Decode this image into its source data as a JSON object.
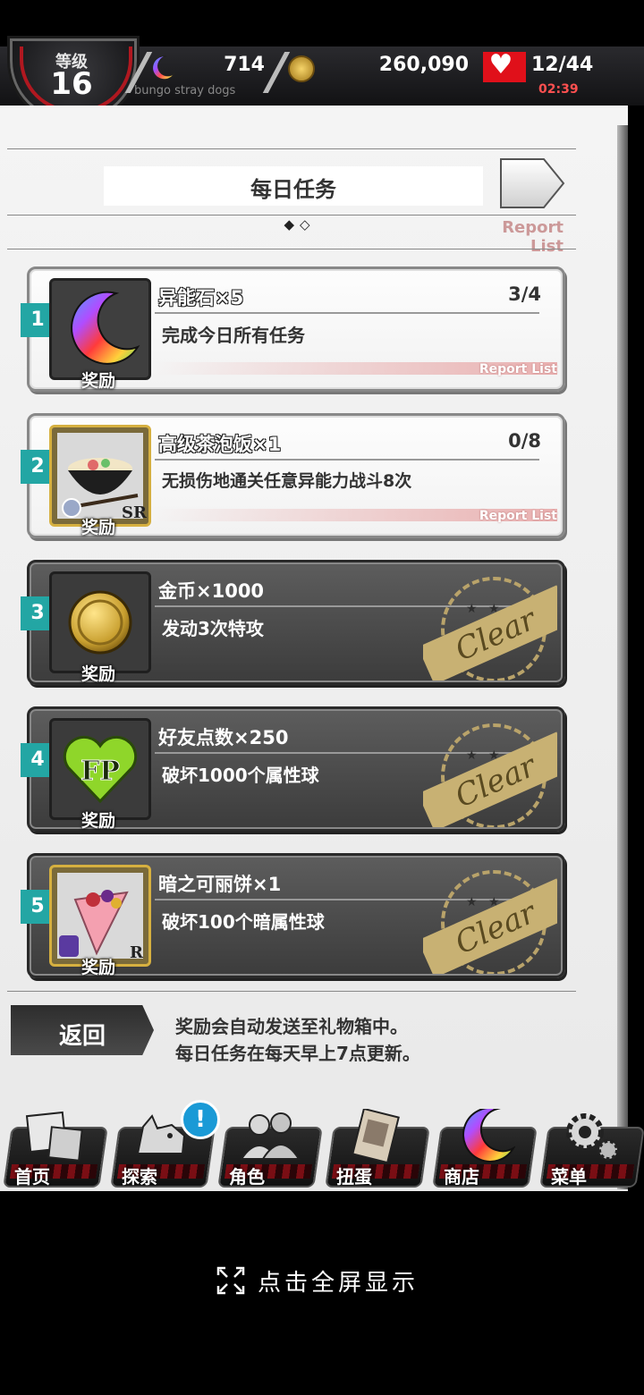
{
  "status": {
    "level_label": "等级",
    "level": "16",
    "stones": "714",
    "coins": "260,090",
    "stamina": "12/44",
    "stamina_timer": "02:39",
    "subtitle": "bungo stray dogs"
  },
  "header": {
    "title": "每日任务",
    "page_dots": "◆◇",
    "report_list": "Report List"
  },
  "missions": [
    {
      "number": "1",
      "reward_name": "异能石×5",
      "description": "完成今日所有任务",
      "progress": "3/4",
      "reward_label": "奖励",
      "report": "Report List",
      "state": "active",
      "icon": "crescent-gem-icon"
    },
    {
      "number": "2",
      "reward_name": "高级茶泡饭×1",
      "description": "无损伤地通关任意异能力战斗8次",
      "progress": "0/8",
      "reward_label": "奖励",
      "report": "Report List",
      "state": "active",
      "icon": "rice-bowl-icon",
      "rarity": "SR"
    },
    {
      "number": "3",
      "reward_name": "金币×1000",
      "description": "发动3次特攻",
      "reward_label": "奖励",
      "state": "clear",
      "icon": "gold-coin-icon"
    },
    {
      "number": "4",
      "reward_name": "好友点数×250",
      "description": "破坏1000个属性球",
      "reward_label": "奖励",
      "state": "clear",
      "icon": "fp-heart-icon",
      "fp_text": "FP"
    },
    {
      "number": "5",
      "reward_name": "暗之可丽饼×1",
      "description": "破坏100个暗属性球",
      "reward_label": "奖励",
      "state": "clear",
      "icon": "crepe-icon",
      "rarity": "R"
    }
  ],
  "stamp": {
    "text": "Clear",
    "stars": "★ ★"
  },
  "footer": {
    "back_label": "返回",
    "note_line1": "奖励会自动发送至礼物箱中。",
    "note_line2": "每日任务在每天早上7点更新。"
  },
  "nav": [
    {
      "label": "首页",
      "icon": "home-book-icon"
    },
    {
      "label": "探索",
      "icon": "explore-dog-icon"
    },
    {
      "label": "角色",
      "icon": "characters-icon"
    },
    {
      "label": "扭蛋",
      "icon": "gacha-card-icon"
    },
    {
      "label": "商店",
      "icon": "shop-gem-icon"
    },
    {
      "label": "菜单",
      "icon": "menu-gear-icon"
    }
  ],
  "notification_badge": "!",
  "fullscreen_hint": "点击全屏显示",
  "colors": {
    "accent_teal": "#23a6a4",
    "stamina_red": "#e0101a",
    "stamp_gold": "#c8b173"
  }
}
